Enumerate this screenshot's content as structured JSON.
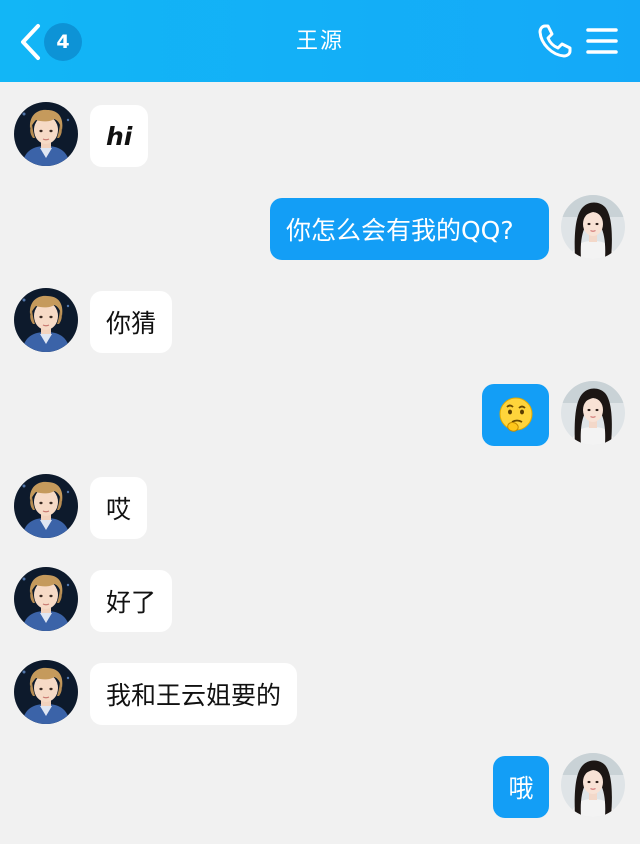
{
  "header": {
    "back_icon": "chevron-left-icon",
    "unread_count": "4",
    "title": "王源",
    "call_icon": "phone-icon",
    "menu_icon": "menu-icon",
    "background_color": "#14aef7"
  },
  "messages": [
    {
      "side": "incoming",
      "text": "hi"
    },
    {
      "side": "outgoing",
      "text": "你怎么会有我的QQ?"
    },
    {
      "side": "incoming",
      "text": "你猜"
    },
    {
      "side": "outgoing",
      "text": "",
      "emoji": "thinking-face-emoji"
    },
    {
      "side": "incoming",
      "text": "哎"
    },
    {
      "side": "incoming",
      "text": "好了"
    },
    {
      "side": "incoming",
      "text": "我和王云姐要的"
    },
    {
      "side": "outgoing",
      "text": "哦"
    }
  ],
  "colors": {
    "outgoing_bubble": "#139ef6",
    "incoming_bubble": "#ffffff",
    "chat_background": "#f1f1f1"
  }
}
